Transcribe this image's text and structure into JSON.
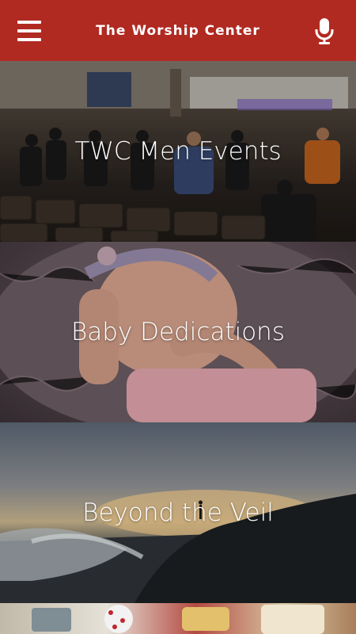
{
  "header": {
    "title": "The Worship Center",
    "menu_icon": "menu-icon",
    "mic_icon": "microphone-icon",
    "background_color": "#b02a22"
  },
  "tiles": [
    {
      "label": "TWC Men Events"
    },
    {
      "label": "Baby Dedications"
    },
    {
      "label": "Beyond the Veil"
    },
    {
      "label": ""
    }
  ]
}
